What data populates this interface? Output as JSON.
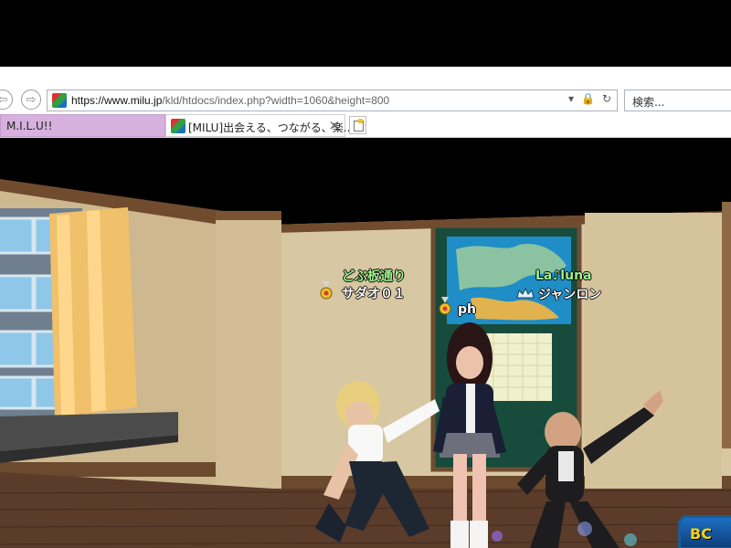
{
  "browser": {
    "address_host": "https://www.milu.jp",
    "address_path": "/kld/htdocs/index.php?width=1060&height=800",
    "search_placeholder": "検索...",
    "tabs": [
      {
        "label": "M.I.L.U!!"
      },
      {
        "label": "[MILU]出会える、つながる、楽..."
      }
    ],
    "nav_icons": [
      "back-arrow-icon",
      "forward-arrow-icon",
      "dropdown-icon",
      "lock-icon",
      "refresh-icon",
      "close-icon",
      "new-tab-icon"
    ]
  },
  "game": {
    "characters": [
      {
        "group": "どぶ板通り",
        "name": "サダオ０１"
      },
      {
        "name": "ph"
      },
      {
        "group": "La♪luna",
        "name": "ジャンロン"
      }
    ],
    "button_label": "BC",
    "colors": {
      "wall": "#d8c8a3",
      "trim": "#6b4a2d",
      "floor": "#5a3b2a",
      "window": "#8fc7e8",
      "curtain": "#f0c06b",
      "map": "#1f7fa8"
    }
  }
}
